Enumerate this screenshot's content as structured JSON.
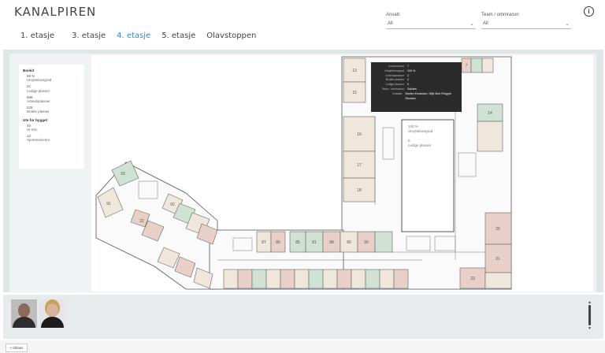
{
  "app": {
    "title": "KANALPIREN"
  },
  "tabs": [
    {
      "label": "1. etasje",
      "active": false
    },
    {
      "label": "3. etasje",
      "active": false
    },
    {
      "label": "4. etasje",
      "active": true
    },
    {
      "label": "5. etasje",
      "active": false
    },
    {
      "label": "Olavstoppen",
      "active": false
    }
  ],
  "filters": {
    "f1": {
      "label": "Ansatt",
      "value": "All"
    },
    "f2": {
      "label": "Team / ommrasvn",
      "value": "All"
    }
  },
  "legend": {
    "section1": "Bookit",
    "items1": [
      {
        "value": "68 %",
        "label": "Utnyttelsesgrad"
      },
      {
        "value": "21",
        "label": "Ledige plasser"
      },
      {
        "value": "686",
        "label": "Arbeidsplasser"
      },
      {
        "value": "535",
        "label": "Brukte plasser"
      }
    ],
    "section2": "Ute for bygget",
    "items2": [
      {
        "value": "45",
        "label": "Hi-mlo"
      },
      {
        "value": "12",
        "label": "Hjemmekontor"
      }
    ]
  },
  "tooltip": {
    "rows": [
      {
        "k": "Kontorromm",
        "v": "7"
      },
      {
        "k": "Utnyttelsesgrad",
        "v": "100 %"
      },
      {
        "k": "Arbeidsplasser",
        "v": "2"
      },
      {
        "k": "Brukte plasser",
        "v": "2"
      },
      {
        "k": "Ledige plasser",
        "v": "0"
      },
      {
        "k": "Team / ommrasvn",
        "v": "Solides"
      },
      {
        "k": "Ansatte",
        "v": "Morten Emanlsen, Silje Moe Ringpst Ruxluen"
      }
    ]
  },
  "plan_overlay": {
    "pct": "100 %",
    "pct_label": "Utnyttelsesgrad",
    "free": "0",
    "free_label": "Ledige plasser"
  },
  "rooms": [
    {
      "id": "r13",
      "label": "13"
    },
    {
      "id": "r15",
      "label": "15"
    },
    {
      "id": "r16",
      "label": "16"
    },
    {
      "id": "r17",
      "label": "17"
    },
    {
      "id": "r18",
      "label": "18"
    },
    {
      "id": "r14",
      "label": "14"
    },
    {
      "id": "r93",
      "label": "93"
    },
    {
      "id": "r91",
      "label": "91"
    },
    {
      "id": "r92",
      "label": "92"
    },
    {
      "id": "r87",
      "label": "87"
    },
    {
      "id": "r86",
      "label": "86"
    },
    {
      "id": "r85",
      "label": "85"
    },
    {
      "id": "r81",
      "label": "81"
    },
    {
      "id": "r88",
      "label": "88"
    },
    {
      "id": "r89",
      "label": "89"
    },
    {
      "id": "r90",
      "label": "90"
    },
    {
      "id": "r20",
      "label": "20"
    },
    {
      "id": "r21",
      "label": "21"
    },
    {
      "id": "r22",
      "label": "22"
    },
    {
      "id": "r23",
      "label": "23"
    },
    {
      "id": "r7",
      "label": "7"
    }
  ],
  "colors": {
    "pink": "#e8d0c8",
    "green": "#cfe2d4",
    "beige": "#efe6dc",
    "wall": "#555555"
  },
  "footer": {
    "back": "< tilbake"
  }
}
